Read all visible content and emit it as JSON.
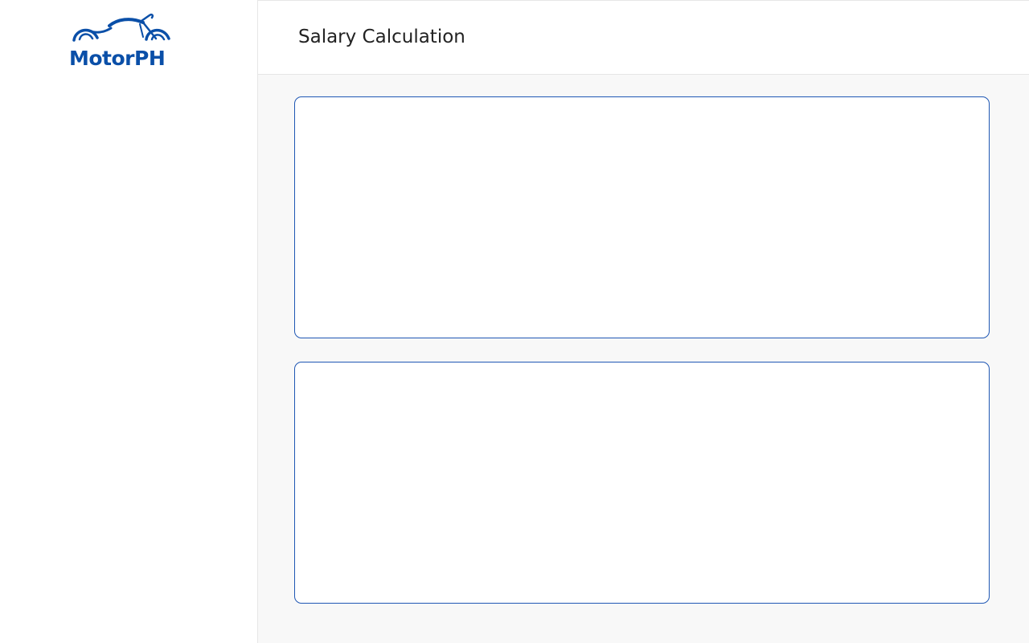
{
  "brand": {
    "name": "MotorPH",
    "color": "#0a4fa8",
    "logo_icon": "motorcycle-icon"
  },
  "header": {
    "title": "Salary Calculation"
  },
  "colors": {
    "card_border": "#1f57b4",
    "main_background": "#f8f8f8",
    "title_text": "#222222"
  }
}
